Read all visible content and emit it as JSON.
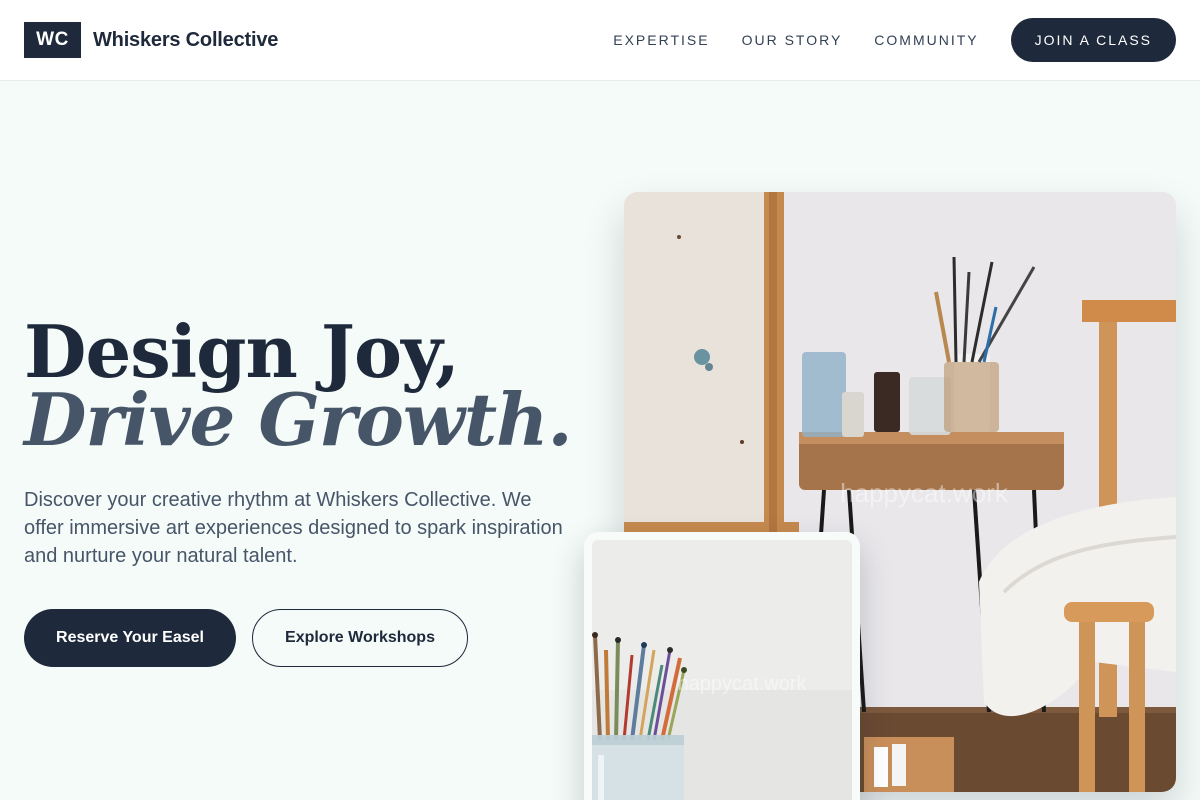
{
  "brand": {
    "mark": "WC",
    "name": "Whiskers Collective"
  },
  "nav": {
    "links": [
      "EXPERTISE",
      "OUR STORY",
      "COMMUNITY"
    ],
    "cta": "JOIN A CLASS"
  },
  "hero": {
    "title_line1": "Design Joy,",
    "title_line2": "Drive Growth.",
    "subtitle": "Discover your creative rhythm at Whiskers Collective. We offer immersive art experiences designed to spark inspiration and nurture your natural talent.",
    "primary_button": "Reserve Your Easel",
    "secondary_button": "Explore Workshops"
  },
  "images": {
    "main": {
      "watermark": "happycat.work"
    },
    "secondary": {
      "watermark": "happycat.work"
    }
  },
  "colors": {
    "primary": "#1e293b",
    "accent_text": "#475569",
    "background": "#f4fbf8"
  }
}
